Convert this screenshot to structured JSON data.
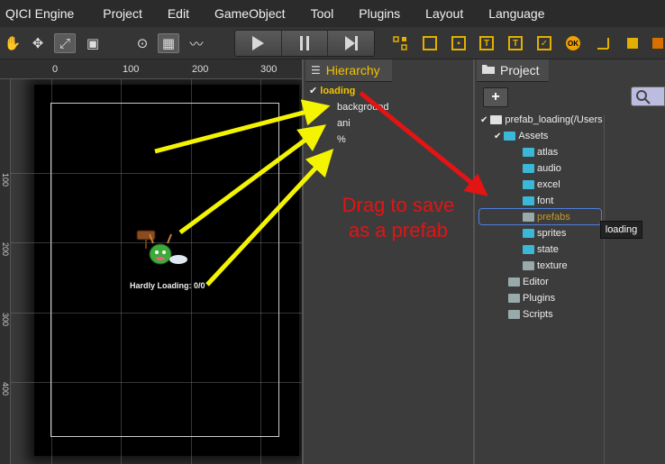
{
  "menu": {
    "items": [
      "QICI Engine",
      "Project",
      "Edit",
      "GameObject",
      "Tool",
      "Plugins",
      "Layout",
      "Language"
    ]
  },
  "scene": {
    "ruler_top": [
      "0",
      "100",
      "200",
      "300"
    ],
    "ruler_left": [
      "100",
      "200",
      "300",
      "400"
    ],
    "loading_label": "Hardly Loading: 0/0"
  },
  "hierarchy": {
    "title": "Hierarchy",
    "root": "loading",
    "children": [
      "background",
      "ani",
      "%"
    ]
  },
  "project": {
    "title": "Project",
    "add_label": "+",
    "root": "prefab_loading(/Users",
    "assets_label": "Assets",
    "asset_folders": [
      "atlas",
      "audio",
      "excel",
      "font",
      "prefabs",
      "sprites",
      "state",
      "texture"
    ],
    "top_folders": [
      "Editor",
      "Plugins",
      "Scripts"
    ],
    "tooltip": "loading"
  },
  "annotation": {
    "line1": "Drag to save",
    "line2": "as a prefab"
  },
  "colors": {
    "accent_yellow": "#f2c200",
    "arrow_yellow": "#f4f400",
    "arrow_red": "#e21414",
    "selection_blue": "#4e7fe0"
  }
}
